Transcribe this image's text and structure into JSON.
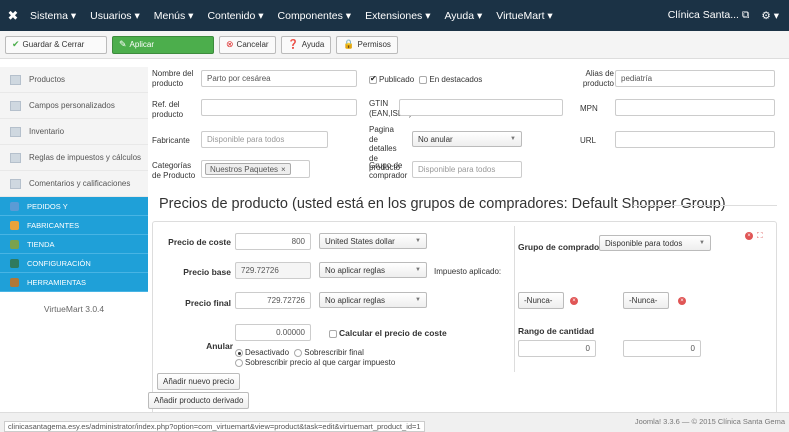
{
  "topnav": {
    "menu": [
      "Sistema ▾",
      "Usuarios ▾",
      "Menús ▾",
      "Contenido ▾",
      "Componentes ▾",
      "Extensiones ▾",
      "Ayuda ▾",
      "VirtueMart ▾"
    ],
    "site_name": "Clínica Santa...",
    "external_icon": "external-link-icon",
    "gear": "⚙ ▾"
  },
  "toolbar": {
    "save_close": "Guardar & Cerrar",
    "apply": "Aplicar",
    "cancel": "Cancelar",
    "help": "Ayuda",
    "permissions": "Permisos"
  },
  "sidebar": {
    "items": [
      {
        "label": "Productos",
        "icon": "products-icon"
      },
      {
        "label": "Campos personalizados",
        "icon": "custom-fields-icon"
      },
      {
        "label": "Inventario",
        "icon": "inventory-icon"
      },
      {
        "label": "Reglas de impuestos y cálculos",
        "icon": "tax-rules-icon"
      },
      {
        "label": "Comentarios y calificaciones",
        "icon": "comments-icon"
      }
    ],
    "groups": [
      {
        "label": "PEDIDOS Y",
        "icon": "orders-icon",
        "color": "#5b9bd5"
      },
      {
        "label": "FABRICANTES",
        "icon": "manufacturers-icon",
        "color": "#e8a33b"
      },
      {
        "label": "TIENDA",
        "icon": "store-icon",
        "color": "#7aa24d"
      },
      {
        "label": "CONFIGURACIÓN",
        "icon": "configuration-icon",
        "color": "#2f7a5f"
      },
      {
        "label": "HERRAMIENTAS",
        "icon": "tools-icon",
        "color": "#b07838"
      }
    ],
    "version": "VirtueMart 3.0.4"
  },
  "form": {
    "nombre_label": "Nombre del producto",
    "nombre_value": "Parto por cesárea",
    "publicado_label": "Publicado",
    "destacados_label": "En destacados",
    "alias_label": "Alias de producto",
    "alias_value": "pediatría",
    "ref_label": "Ref. del producto",
    "gtin_label": "GTIN (EAN,ISBN)",
    "mpn_label": "MPN",
    "fabricante_label": "Fabricante",
    "fabricante_placeholder": "Disponible para todos",
    "pagina_label": "Pagina de detalles de producto",
    "pagina_value": "No anular",
    "url_label": "URL",
    "categorias_label": "Categorías de Producto",
    "categoria_tag": "Nuestros Paquetes",
    "grupo_label": "Grupo de comprador",
    "grupo_placeholder": "Disponible para todos"
  },
  "pricing": {
    "title": "Precios de producto (usted está en los grupos de compradores: Default Shopper Group)",
    "coste_label": "Precio de coste",
    "coste_value": "800",
    "currency": "United States dollar",
    "base_label": "Precio base",
    "base_value": "729.72726",
    "base_rule": "No aplicar reglas",
    "impuesto_label": "Impuesto aplicado:",
    "final_label": "Precio final",
    "final_value": "729.72726",
    "final_rule": "No aplicar reglas",
    "anular_label": "Anular",
    "anular_value": "0.00000",
    "calc_label": "Calcular el precio de coste",
    "desactivado_label": "Desactivado",
    "sobrescribir_label": "Sobrescribir final",
    "sobrescribir_impuesto_label": "Sobrescribir precio al que cargar impuesto",
    "grupo_comprador_label": "Grupo de comprador",
    "grupo_comprador_value": "Disponible para todos",
    "nunca_1": "-Nunca-",
    "nunca_2": "-Nunca-",
    "rango_label": "Rango de cantidad",
    "rango_min": "0",
    "rango_max": "0",
    "add_price": "Añadir nuevo precio",
    "add_derived": "Añadir producto derivado"
  },
  "footer": {
    "url": "clinicasantagema.esy.es/administrator/index.php?option=com_virtuemart&view=product&task=edit&virtuemart_product_id=1",
    "copyright": "Joomla! 3.3.6 — © 2015 Clínica Santa Gema"
  }
}
